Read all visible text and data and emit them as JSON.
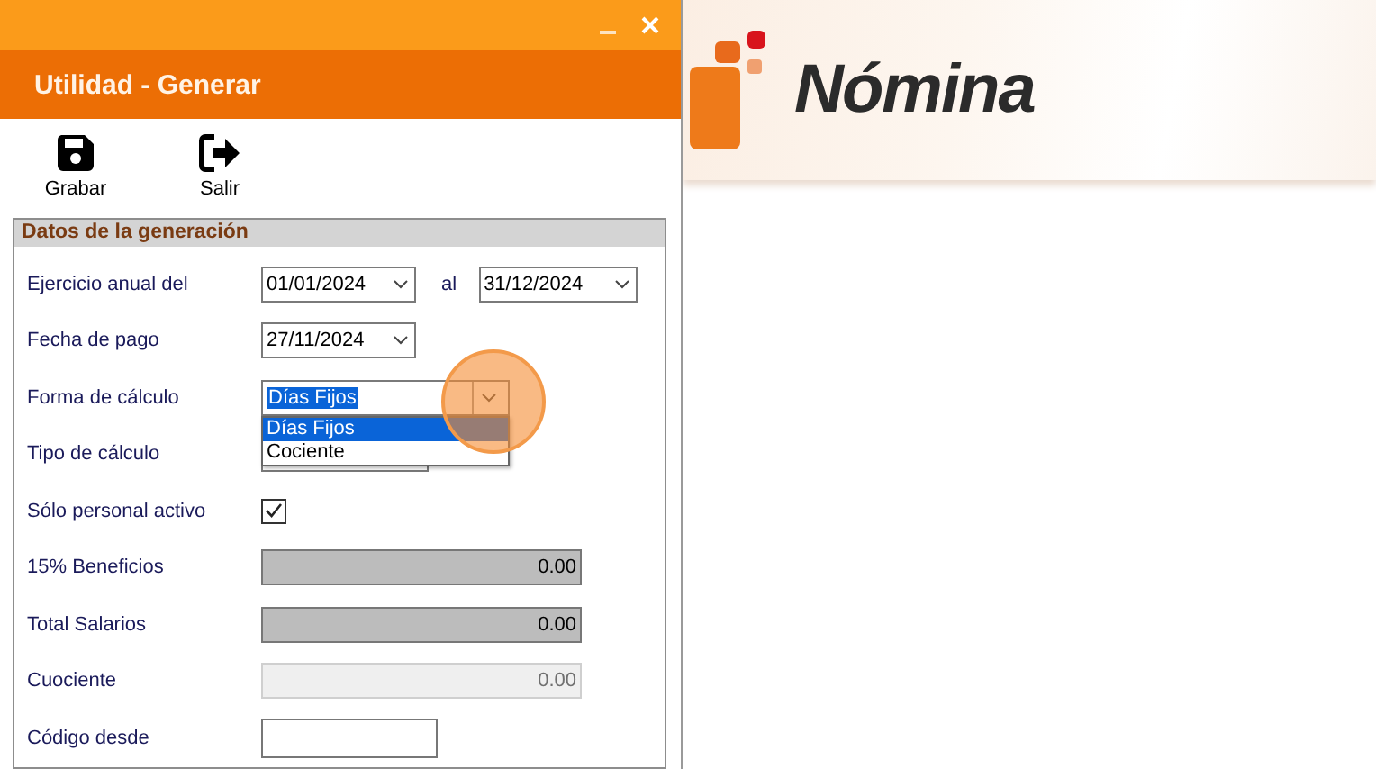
{
  "window": {
    "title": "Utilidad - Generar"
  },
  "toolbar": [
    {
      "kind": "save",
      "label": "Grabar"
    },
    {
      "kind": "exit",
      "label": "Salir"
    }
  ],
  "group": {
    "title": "Datos de la generación"
  },
  "fields": [
    {
      "kind": "daterange",
      "label": "Ejercicio anual del",
      "value": "01/01/2024",
      "joiner": "al",
      "value_2": "31/12/2024"
    },
    {
      "kind": "date",
      "label": "Fecha de pago",
      "value": "27/11/2024"
    },
    {
      "kind": "combo",
      "label": "Forma de cálculo",
      "value": "Días Fijos",
      "open": true,
      "options": [
        {
          "label": "Días Fijos",
          "selected": true
        },
        {
          "label": "Cociente",
          "selected": false
        }
      ]
    },
    {
      "kind": "combo",
      "label": "Tipo de cálculo",
      "open": false
    },
    {
      "kind": "checkbox",
      "label": "Sólo personal activo",
      "checked": true
    },
    {
      "kind": "amount",
      "label": "15% Beneficios",
      "value": "0.00",
      "disabled": false
    },
    {
      "kind": "amount",
      "label": "Total Salarios",
      "value": "0.00",
      "disabled": false
    },
    {
      "kind": "amount",
      "label": "Cuociente",
      "value": "0.00",
      "disabled": true
    },
    {
      "kind": "text",
      "label": "Código desde"
    }
  ],
  "app": {
    "logo_text": "Nómina"
  }
}
